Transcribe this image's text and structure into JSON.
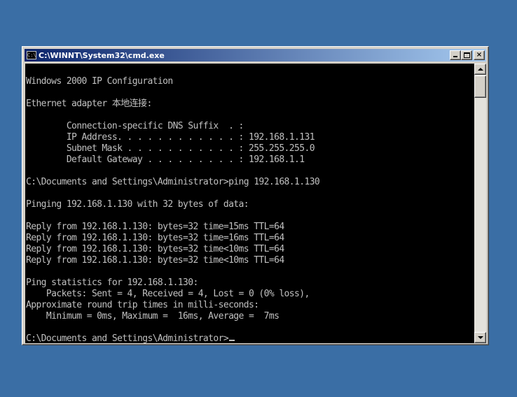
{
  "window": {
    "title": "C:\\WINNT\\System32\\cmd.exe",
    "icon": "console-icon",
    "icon_glyph": "C:\\",
    "buttons": {
      "minimize_icon": "minimize-icon",
      "maximize_icon": "maximize-icon",
      "close_icon": "close-icon",
      "close_glyph": "×"
    }
  },
  "console": {
    "foreground": "#c0c0c0",
    "background": "#000000",
    "lines": [
      "",
      "Windows 2000 IP Configuration",
      "",
      "Ethernet adapter 本地连接:",
      "",
      "        Connection-specific DNS Suffix  . :",
      "        IP Address. . . . . . . . . . . . : 192.168.1.131",
      "        Subnet Mask . . . . . . . . . . . : 255.255.255.0",
      "        Default Gateway . . . . . . . . . : 192.168.1.1",
      "",
      "C:\\Documents and Settings\\Administrator>ping 192.168.1.130",
      "",
      "Pinging 192.168.1.130 with 32 bytes of data:",
      "",
      "Reply from 192.168.1.130: bytes=32 time=15ms TTL=64",
      "Reply from 192.168.1.130: bytes=32 time=16ms TTL=64",
      "Reply from 192.168.1.130: bytes=32 time<10ms TTL=64",
      "Reply from 192.168.1.130: bytes=32 time<10ms TTL=64",
      "",
      "Ping statistics for 192.168.1.130:",
      "    Packets: Sent = 4, Received = 4, Lost = 0 (0% loss),",
      "Approximate round trip times in milli-seconds:",
      "    Minimum = 0ms, Maximum =  16ms, Average =  7ms",
      "",
      "C:\\Documents and Settings\\Administrator>"
    ]
  },
  "colors": {
    "desktop": "#3a6ea5",
    "titlebar_start": "#0a246a",
    "titlebar_end": "#a6caf0",
    "chrome": "#d4d0c8"
  }
}
